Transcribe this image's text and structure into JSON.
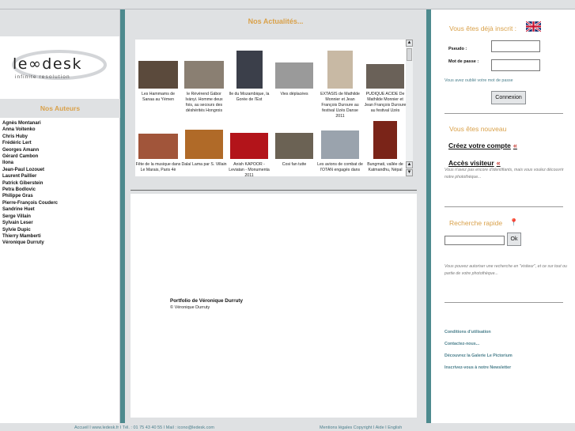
{
  "logo": {
    "wordmark": "le∞desk",
    "tagline": "infinite resolution"
  },
  "authors": {
    "title": "Nos Auteurs",
    "items": [
      "Agnès Montanari",
      "Anna Voitenko",
      "Chris Huby",
      "Frédéric Lert",
      "Georges Amann",
      "Gérard Cambon",
      "Ilona",
      "Jean-Paul Lozouet",
      "Laurent Paillier",
      "Patrick Giberstein",
      "Petra Bodlovic",
      "Philippe Gras",
      "Pierre-François Couderc",
      "Sandrine Huet",
      "Serge Villain",
      "Sylvain Leser",
      "Sylvie Dupic",
      "Thierry Mamberti",
      "Véronique Durruty"
    ]
  },
  "news": {
    "title": "Nos Actualités...",
    "items": [
      {
        "caption": "Les Hammams de Sanaa au Yémen",
        "color": "#5b4a3c"
      },
      {
        "caption": "le Révérend Gábor Iványi. Homme deux fois, au secours des déshérités Hongrois",
        "color": "#8a7f72"
      },
      {
        "caption": "Ile du Mozambique, la Gorée de l'Est",
        "color": "#3b3f4a"
      },
      {
        "caption": "Vies déplacées",
        "color": "#9a9a9a"
      },
      {
        "caption": "EXTASIS de Mathilde Monnier et Jean François Duroure au festival Uzès Danse 2011",
        "color": "#c8b9a4"
      },
      {
        "caption": "PUDIQUE ACIDE De Mathilde Monnier et Jean François Duroure au festival Uzès",
        "color": "#6a6158"
      },
      {
        "caption": "Fête de la musique dans Le Marais, Paris 4è",
        "color": "#a1553a"
      },
      {
        "caption": "Dalaï Lama par S. Villain",
        "color": "#b06a28"
      },
      {
        "caption": "Anish KAPOOR - Leviatan - Monumenta 2011",
        "color": "#b3141a"
      },
      {
        "caption": "Cosi fan tutte",
        "color": "#6b6254"
      },
      {
        "caption": "Les avions de combat de l'OTAN engagés dans",
        "color": "#9aa3ad"
      },
      {
        "caption": "Bungmati, vallée de Katmandhu, Népal",
        "color": "#7a2418"
      }
    ]
  },
  "portfolio": {
    "title": "Portfolio de Véronique Durruty",
    "copyright": "© Véronique Durruty"
  },
  "login": {
    "title": "Vous êtes déjà inscrit :",
    "pseudo_label": "Pseudo :",
    "password_label": "Mot de passe :",
    "forgot": "Vous avez oublié votre mot de passe",
    "button": "Connexion"
  },
  "new_user": {
    "title": "Vous êtes nouveau",
    "create": "Créez votre compte",
    "visitor": "Accès visiteur",
    "note": "Vous n'avez pas encore d'identifiants, mais vous voulez découvrir notre photothèque..."
  },
  "search": {
    "title": "Recherche rapide",
    "button": "Ok",
    "note": "Vous pouvez autoriser une recherche en \"visiteur\", et ce sur tout ou partie de votre photothèque..."
  },
  "links": [
    "Conditions d'utilisation",
    "Contactez-nous...",
    "Découvrez la Galerie Le Pictorium",
    "Inscrivez-vous à notre Newsletter"
  ],
  "footer": {
    "left": "Accueil I www.ledesk.fr I Tél. : 01 75 43 40 55 I Mail : icono@ledesk.com",
    "right": "Mentions légales Copyright I Aide I English"
  },
  "colors": {
    "accent": "#d9a14a",
    "teal": "#4d8a8e",
    "link": "#4a7f8c"
  }
}
